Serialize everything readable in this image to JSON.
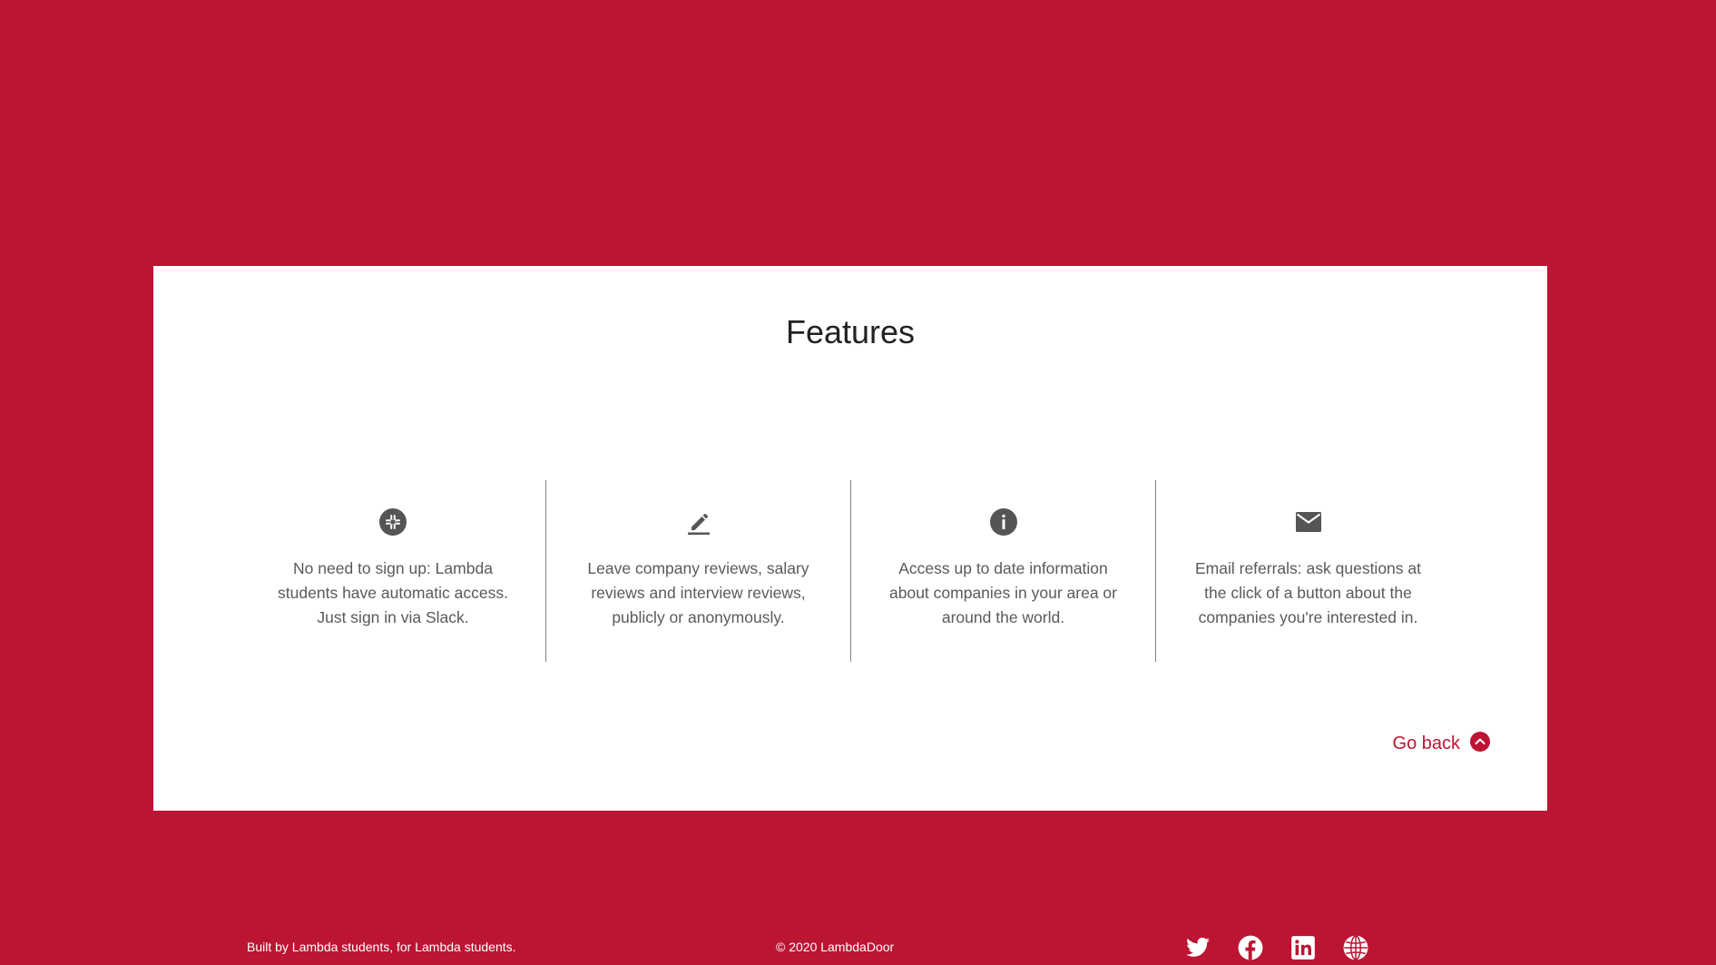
{
  "colors": {
    "background": "#bc1433",
    "accent": "#bc1433",
    "card": "#ffffff",
    "icon": "#555555",
    "text": "#5a5a5a",
    "divider": "#808080"
  },
  "features": {
    "title": "Features",
    "items": [
      {
        "icon": "slack-icon",
        "text": "No need to sign up: Lambda students have automatic access. Just sign in via Slack."
      },
      {
        "icon": "pencil-icon",
        "text": "Leave company reviews, salary reviews and interview reviews, publicly or anonymously."
      },
      {
        "icon": "info-icon",
        "text": "Access up to date information about companies in your area or around the world."
      },
      {
        "icon": "email-icon",
        "text": "Email referrals: ask questions at the click of a button about the companies you're interested in."
      }
    ],
    "go_back_label": "Go back",
    "go_back_icon": "chevron-up-circle-icon"
  },
  "footer": {
    "credit": "Built by Lambda students, for Lambda students.",
    "copyright": "© 2020 LambdaDoor",
    "social": [
      {
        "icon": "twitter-icon"
      },
      {
        "icon": "facebook-icon"
      },
      {
        "icon": "linkedin-icon"
      },
      {
        "icon": "globe-icon"
      }
    ]
  }
}
